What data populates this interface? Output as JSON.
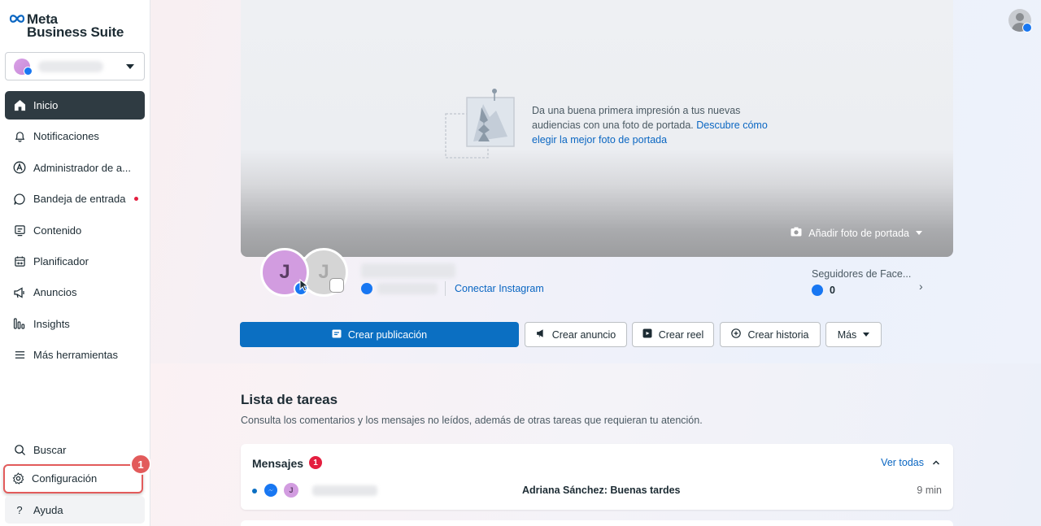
{
  "brand": {
    "line1": "Meta",
    "line2": "Business Suite"
  },
  "sidebar": {
    "items": [
      {
        "label": "Inicio",
        "icon": "home-icon"
      },
      {
        "label": "Notificaciones",
        "icon": "bell-icon"
      },
      {
        "label": "Administrador de a...",
        "icon": "ads-manager-icon"
      },
      {
        "label": "Bandeja de entrada",
        "icon": "inbox-icon"
      },
      {
        "label": "Contenido",
        "icon": "content-icon"
      },
      {
        "label": "Planificador",
        "icon": "calendar-icon"
      },
      {
        "label": "Anuncios",
        "icon": "megaphone-icon"
      },
      {
        "label": "Insights",
        "icon": "insights-icon"
      },
      {
        "label": "Más herramientas",
        "icon": "menu-icon"
      }
    ],
    "bottom": [
      {
        "label": "Buscar",
        "icon": "search-icon"
      },
      {
        "label": "Configuración",
        "icon": "gear-icon"
      },
      {
        "label": "Ayuda",
        "icon": "help-icon"
      }
    ],
    "help_glyph": "?",
    "step_badge": "1"
  },
  "cover": {
    "prompt_text": "Da una buena primera impresión a tus nuevas audiencias con una foto de portada.",
    "prompt_link": "Descubre cómo elegir la mejor foto de portada",
    "add_cover_label": "Añadir foto de portada"
  },
  "profile": {
    "fb_initial": "J",
    "ig_initial": "J",
    "connect_instagram": "Conectar Instagram"
  },
  "followers": {
    "label": "Seguidores de Face...",
    "count": "0"
  },
  "actions": {
    "create_post": "Crear publicación",
    "create_ad": "Crear anuncio",
    "create_reel": "Crear reel",
    "create_story": "Crear historia",
    "more": "Más"
  },
  "tasks": {
    "title": "Lista de tareas",
    "subtitle": "Consulta los comentarios y los mensajes no leídos, además de otras tareas que requieran tu atención."
  },
  "messages_card": {
    "title": "Mensajes",
    "badge": "1",
    "see_all": "Ver todas",
    "rows": [
      {
        "avatar_initial": "J",
        "preview": "Adriana Sánchez: Buenas tardes",
        "time": "9 min"
      }
    ]
  },
  "colors": {
    "primary": "#0b6fc2",
    "active_nav": "#2f3b42",
    "highlight": "#e25b5b",
    "facebook": "#1877f2",
    "notification": "#e41e3f"
  }
}
